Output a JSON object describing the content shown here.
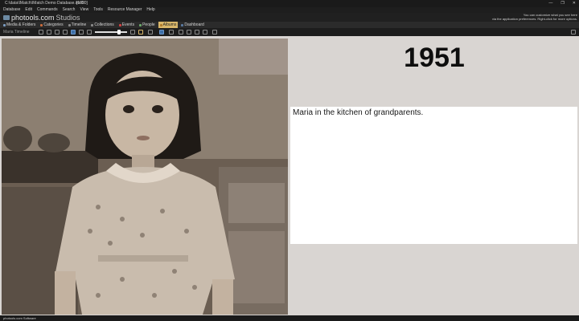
{
  "window": {
    "title": "C:\\data\\IMatch\\IMatch Demo Database.imd5",
    "badge": "[1920]",
    "controls": [
      "—",
      "❐",
      "✕"
    ]
  },
  "menu": [
    "Database",
    "Edit",
    "Commands",
    "Search",
    "View",
    "Tools",
    "Resource Manager",
    "Help"
  ],
  "brand": {
    "name": "photools.com",
    "suffix": "Studios",
    "hint_line1": "You can customize what you see here",
    "hint_line2": "via the application preferences. Right-click for more options."
  },
  "nav": {
    "tabs": [
      {
        "label": "Media & Folders",
        "icon": "folder-icon"
      },
      {
        "label": "Categories",
        "icon": "category-icon"
      },
      {
        "label": "Timeline",
        "icon": "timeline-icon"
      },
      {
        "label": "Collections",
        "icon": "collection-icon"
      },
      {
        "label": "Events",
        "icon": "event-icon"
      },
      {
        "label": "People",
        "icon": "person-icon"
      },
      {
        "label": "Albums",
        "icon": "album-icon"
      },
      {
        "label": "Dashboard",
        "icon": "dashboard-icon"
      }
    ],
    "active": "Albums"
  },
  "toolbar": {
    "label": "Maria Timeline"
  },
  "slide": {
    "year": "1951",
    "caption": "Maria in the kitchen of grandparents."
  },
  "status": {
    "text": "photools.com Software"
  },
  "colors": {
    "accent_tab": "#d8b66a",
    "panel_bg": "#d9d5d2",
    "caption_bg": "#ffffff"
  }
}
